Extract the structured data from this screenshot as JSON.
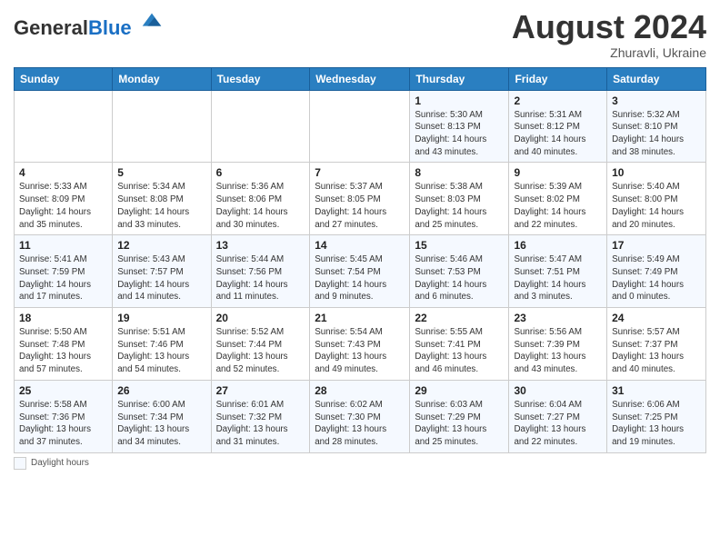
{
  "header": {
    "logo": {
      "general": "General",
      "blue": "Blue"
    },
    "month_year": "August 2024",
    "location": "Zhuravli, Ukraine"
  },
  "weekdays": [
    "Sunday",
    "Monday",
    "Tuesday",
    "Wednesday",
    "Thursday",
    "Friday",
    "Saturday"
  ],
  "weeks": [
    [
      {
        "day": "",
        "info": ""
      },
      {
        "day": "",
        "info": ""
      },
      {
        "day": "",
        "info": ""
      },
      {
        "day": "",
        "info": ""
      },
      {
        "day": "1",
        "info": "Sunrise: 5:30 AM\nSunset: 8:13 PM\nDaylight: 14 hours\nand 43 minutes."
      },
      {
        "day": "2",
        "info": "Sunrise: 5:31 AM\nSunset: 8:12 PM\nDaylight: 14 hours\nand 40 minutes."
      },
      {
        "day": "3",
        "info": "Sunrise: 5:32 AM\nSunset: 8:10 PM\nDaylight: 14 hours\nand 38 minutes."
      }
    ],
    [
      {
        "day": "4",
        "info": "Sunrise: 5:33 AM\nSunset: 8:09 PM\nDaylight: 14 hours\nand 35 minutes."
      },
      {
        "day": "5",
        "info": "Sunrise: 5:34 AM\nSunset: 8:08 PM\nDaylight: 14 hours\nand 33 minutes."
      },
      {
        "day": "6",
        "info": "Sunrise: 5:36 AM\nSunset: 8:06 PM\nDaylight: 14 hours\nand 30 minutes."
      },
      {
        "day": "7",
        "info": "Sunrise: 5:37 AM\nSunset: 8:05 PM\nDaylight: 14 hours\nand 27 minutes."
      },
      {
        "day": "8",
        "info": "Sunrise: 5:38 AM\nSunset: 8:03 PM\nDaylight: 14 hours\nand 25 minutes."
      },
      {
        "day": "9",
        "info": "Sunrise: 5:39 AM\nSunset: 8:02 PM\nDaylight: 14 hours\nand 22 minutes."
      },
      {
        "day": "10",
        "info": "Sunrise: 5:40 AM\nSunset: 8:00 PM\nDaylight: 14 hours\nand 20 minutes."
      }
    ],
    [
      {
        "day": "11",
        "info": "Sunrise: 5:41 AM\nSunset: 7:59 PM\nDaylight: 14 hours\nand 17 minutes."
      },
      {
        "day": "12",
        "info": "Sunrise: 5:43 AM\nSunset: 7:57 PM\nDaylight: 14 hours\nand 14 minutes."
      },
      {
        "day": "13",
        "info": "Sunrise: 5:44 AM\nSunset: 7:56 PM\nDaylight: 14 hours\nand 11 minutes."
      },
      {
        "day": "14",
        "info": "Sunrise: 5:45 AM\nSunset: 7:54 PM\nDaylight: 14 hours\nand 9 minutes."
      },
      {
        "day": "15",
        "info": "Sunrise: 5:46 AM\nSunset: 7:53 PM\nDaylight: 14 hours\nand 6 minutes."
      },
      {
        "day": "16",
        "info": "Sunrise: 5:47 AM\nSunset: 7:51 PM\nDaylight: 14 hours\nand 3 minutes."
      },
      {
        "day": "17",
        "info": "Sunrise: 5:49 AM\nSunset: 7:49 PM\nDaylight: 14 hours\nand 0 minutes."
      }
    ],
    [
      {
        "day": "18",
        "info": "Sunrise: 5:50 AM\nSunset: 7:48 PM\nDaylight: 13 hours\nand 57 minutes."
      },
      {
        "day": "19",
        "info": "Sunrise: 5:51 AM\nSunset: 7:46 PM\nDaylight: 13 hours\nand 54 minutes."
      },
      {
        "day": "20",
        "info": "Sunrise: 5:52 AM\nSunset: 7:44 PM\nDaylight: 13 hours\nand 52 minutes."
      },
      {
        "day": "21",
        "info": "Sunrise: 5:54 AM\nSunset: 7:43 PM\nDaylight: 13 hours\nand 49 minutes."
      },
      {
        "day": "22",
        "info": "Sunrise: 5:55 AM\nSunset: 7:41 PM\nDaylight: 13 hours\nand 46 minutes."
      },
      {
        "day": "23",
        "info": "Sunrise: 5:56 AM\nSunset: 7:39 PM\nDaylight: 13 hours\nand 43 minutes."
      },
      {
        "day": "24",
        "info": "Sunrise: 5:57 AM\nSunset: 7:37 PM\nDaylight: 13 hours\nand 40 minutes."
      }
    ],
    [
      {
        "day": "25",
        "info": "Sunrise: 5:58 AM\nSunset: 7:36 PM\nDaylight: 13 hours\nand 37 minutes."
      },
      {
        "day": "26",
        "info": "Sunrise: 6:00 AM\nSunset: 7:34 PM\nDaylight: 13 hours\nand 34 minutes."
      },
      {
        "day": "27",
        "info": "Sunrise: 6:01 AM\nSunset: 7:32 PM\nDaylight: 13 hours\nand 31 minutes."
      },
      {
        "day": "28",
        "info": "Sunrise: 6:02 AM\nSunset: 7:30 PM\nDaylight: 13 hours\nand 28 minutes."
      },
      {
        "day": "29",
        "info": "Sunrise: 6:03 AM\nSunset: 7:29 PM\nDaylight: 13 hours\nand 25 minutes."
      },
      {
        "day": "30",
        "info": "Sunrise: 6:04 AM\nSunset: 7:27 PM\nDaylight: 13 hours\nand 22 minutes."
      },
      {
        "day": "31",
        "info": "Sunrise: 6:06 AM\nSunset: 7:25 PM\nDaylight: 13 hours\nand 19 minutes."
      }
    ]
  ],
  "legend": {
    "daylight_label": "Daylight hours"
  }
}
